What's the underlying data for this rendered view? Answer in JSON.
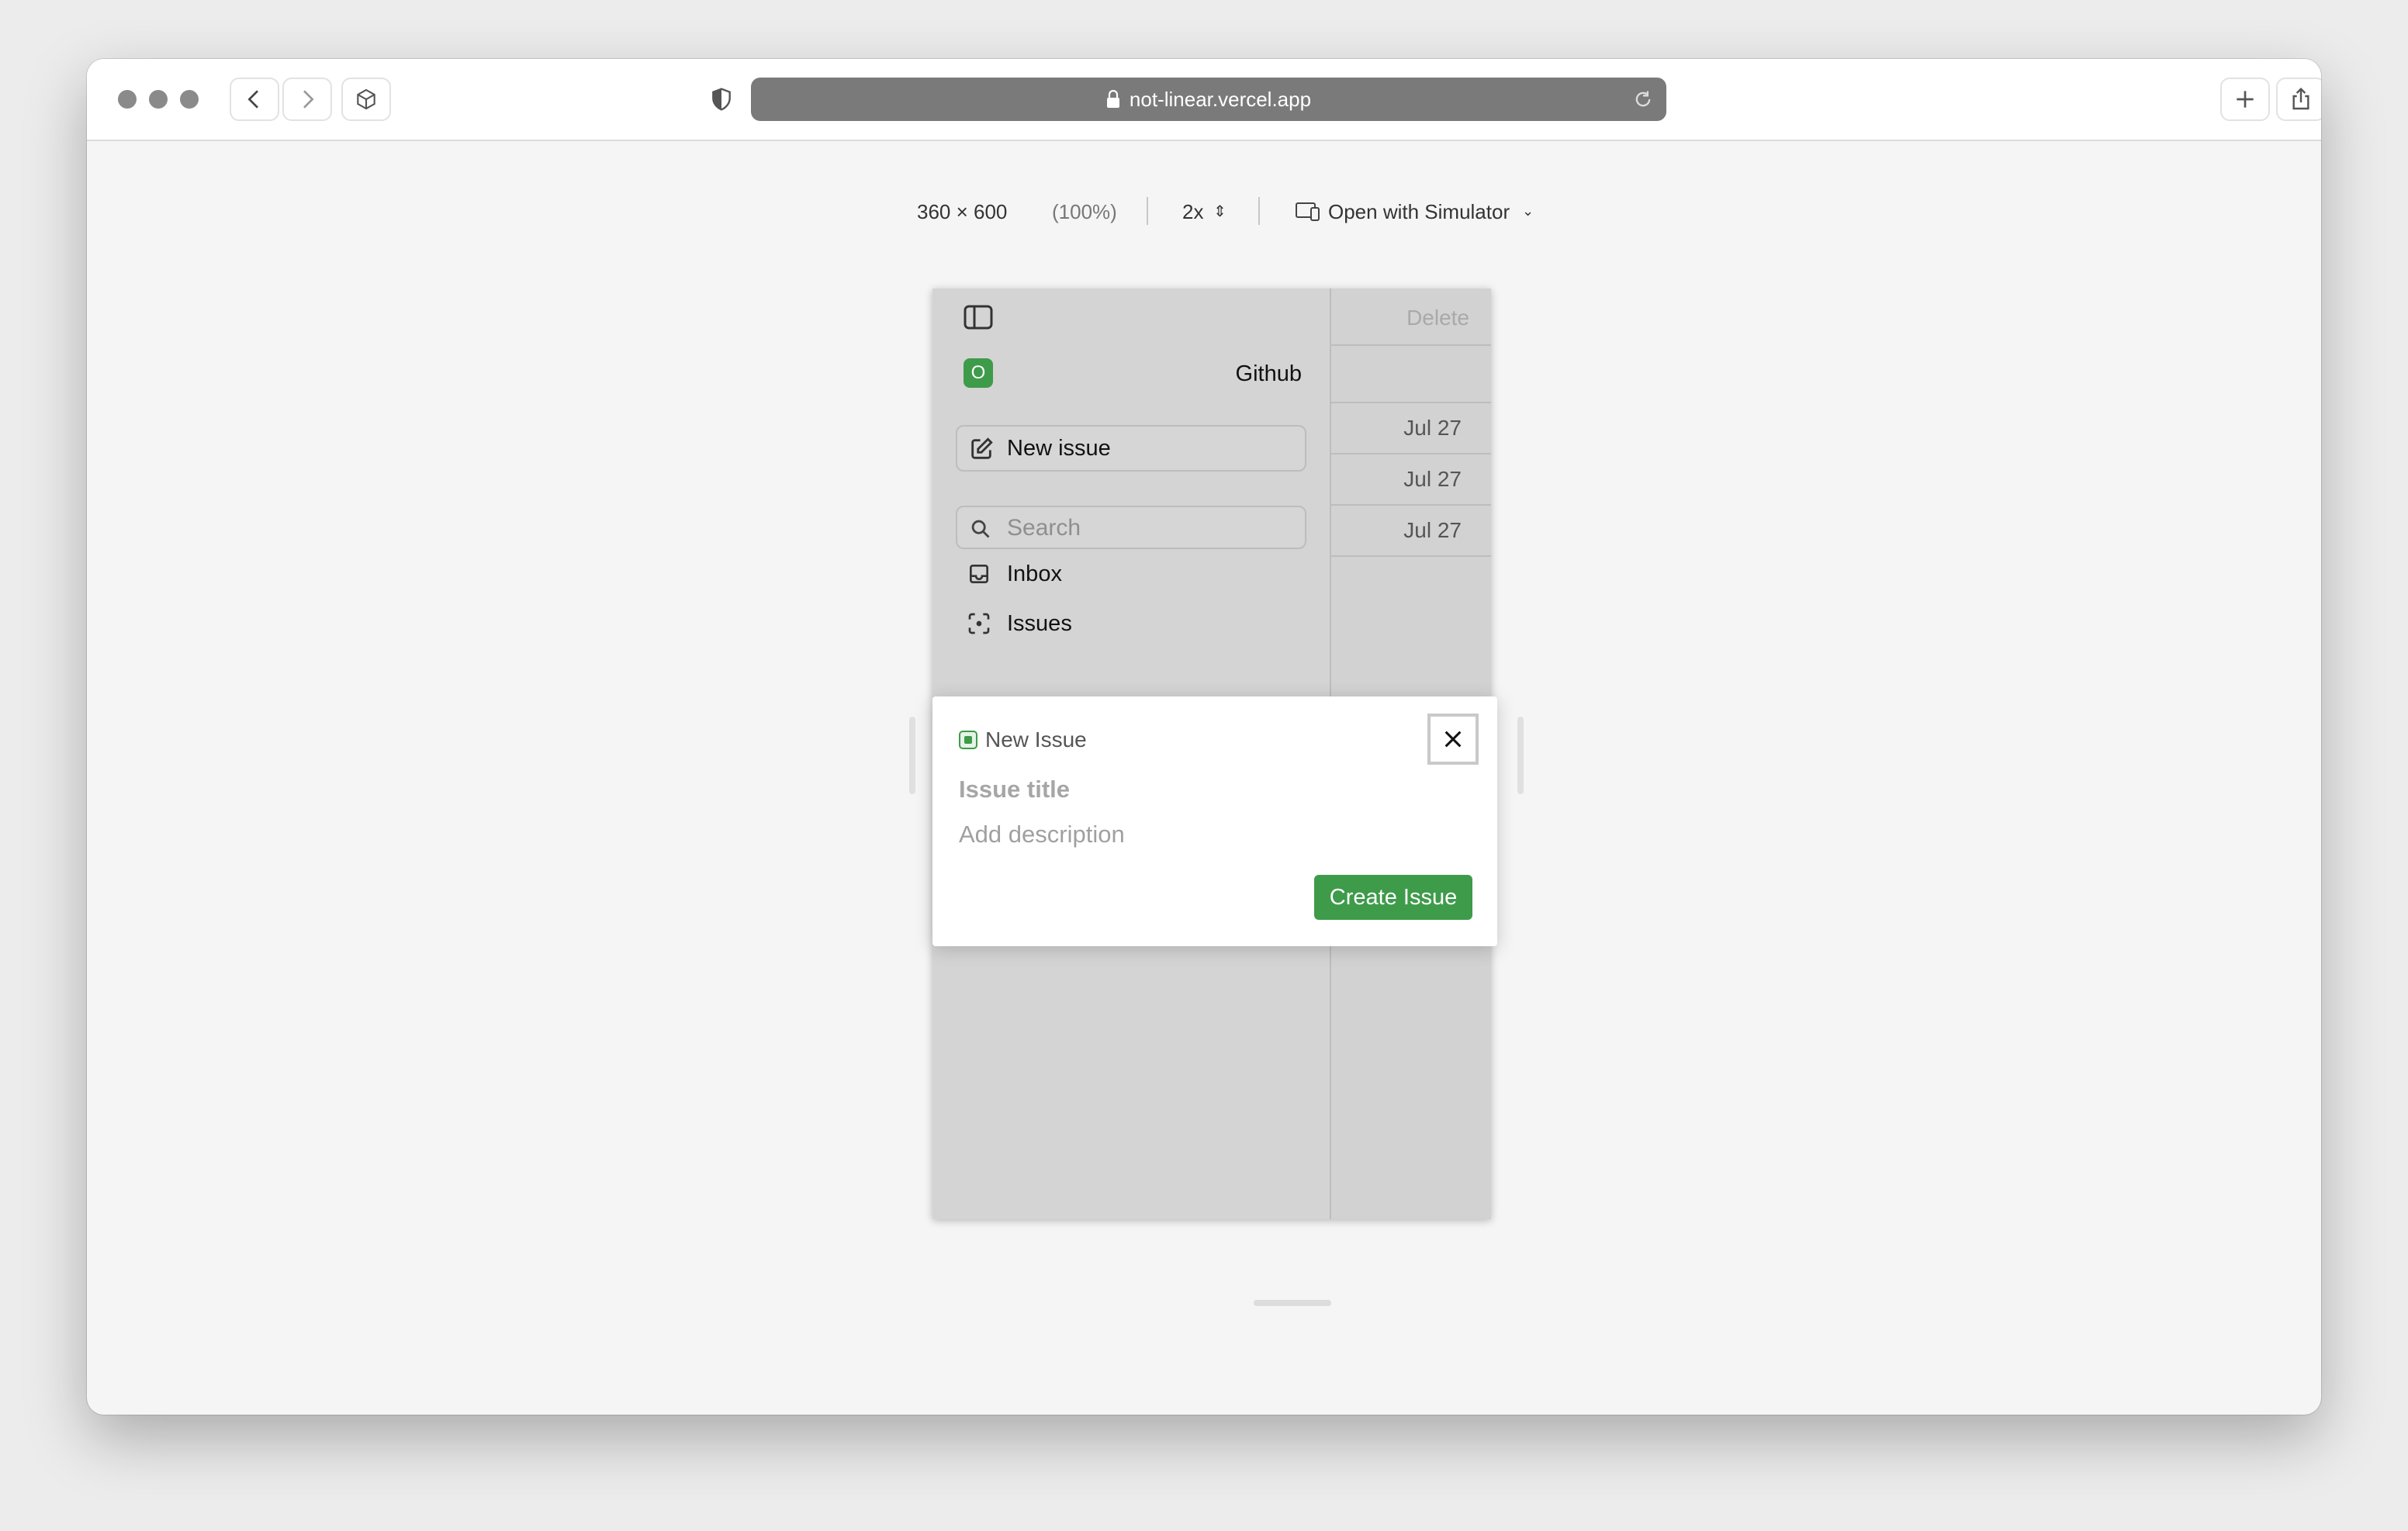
{
  "browser": {
    "url": "not-linear.vercel.app"
  },
  "device_bar": {
    "dimensions": "360 × 600",
    "zoom": "(100%)",
    "scale": "2x",
    "open_with": "Open with Simulator"
  },
  "app": {
    "workspace_initial": "O",
    "workspace_name": "Github",
    "new_issue_label": "New issue",
    "search_placeholder": "Search",
    "nav": [
      "Inbox",
      "Issues"
    ],
    "right_column": {
      "delete_label": "Delete",
      "dates": [
        "Jul 27",
        "Jul 27",
        "Jul 27"
      ]
    }
  },
  "modal": {
    "heading": "New Issue",
    "title_placeholder": "Issue title",
    "description_placeholder": "Add description",
    "create_label": "Create Issue"
  },
  "colors": {
    "accent_green": "#3e9b4a"
  }
}
